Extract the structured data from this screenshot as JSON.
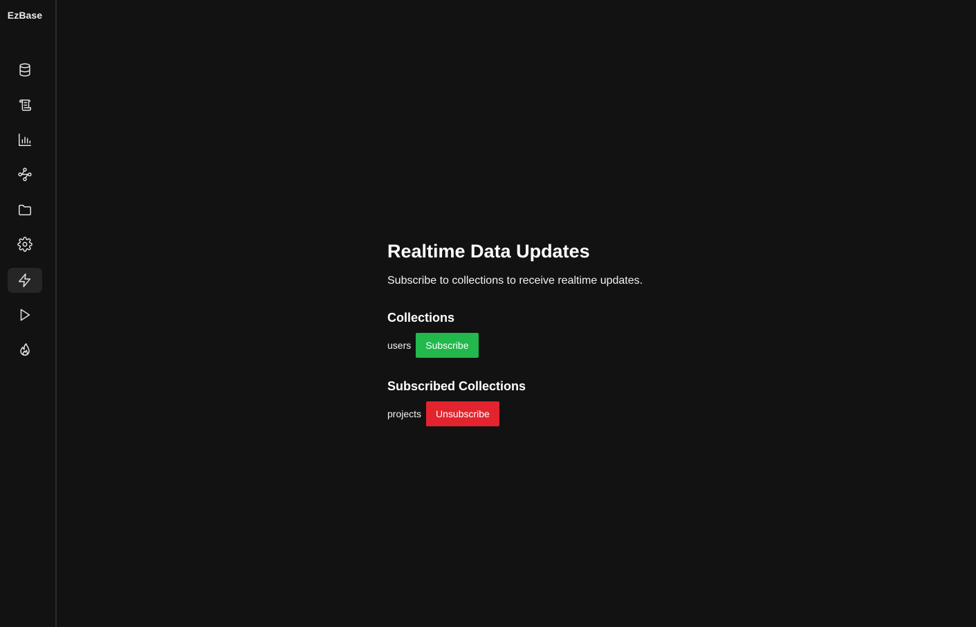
{
  "app": {
    "brand": "EzBase"
  },
  "sidebar": {
    "items": [
      {
        "icon": "database-icon"
      },
      {
        "icon": "scroll-icon"
      },
      {
        "icon": "bar-chart-icon"
      },
      {
        "icon": "workflow-icon"
      },
      {
        "icon": "folder-icon"
      },
      {
        "icon": "gear-icon"
      },
      {
        "icon": "lightning-icon",
        "active": true
      },
      {
        "icon": "play-icon"
      },
      {
        "icon": "flame-icon"
      }
    ]
  },
  "main": {
    "title": "Realtime Data Updates",
    "subtitle": "Subscribe to collections to receive realtime updates.",
    "collections": {
      "heading": "Collections",
      "items": [
        {
          "name": "users",
          "action": "Subscribe"
        }
      ]
    },
    "subscribed": {
      "heading": "Subscribed Collections",
      "items": [
        {
          "name": "projects",
          "action": "Unsubscribe"
        }
      ]
    }
  },
  "colors": {
    "background": "#121212",
    "subscribe": "#22b84c",
    "unsubscribe": "#e3242e",
    "active_nav": "#262626"
  }
}
